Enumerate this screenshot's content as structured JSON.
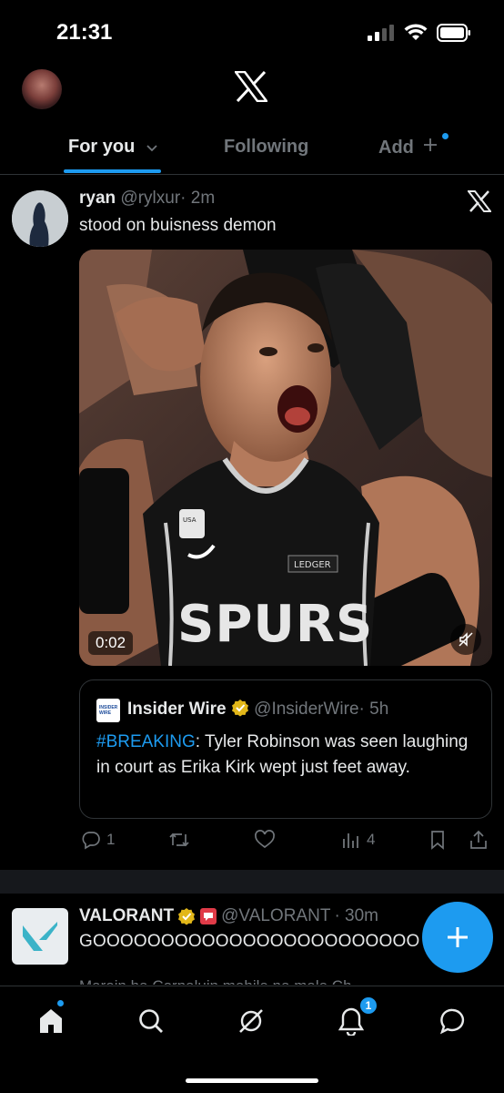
{
  "status_bar": {
    "time": "21:31"
  },
  "header": {
    "logo": "x-logo"
  },
  "tabs": [
    {
      "label": "For you",
      "active": true
    },
    {
      "label": "Following",
      "active": false
    },
    {
      "label": "Add",
      "active": false
    }
  ],
  "tweet1": {
    "name": "ryan",
    "handle": "@rylxur",
    "time": "· 2m",
    "text": "stood on buisness demon",
    "media": {
      "duration": "0:02",
      "muted": true,
      "jersey_text": "SPURS",
      "patch_text": "LEDGER"
    },
    "quote": {
      "avatar_text": "INSIDER WIRE",
      "name": "Insider Wire",
      "verified": true,
      "handle": "@InsiderWire",
      "time": "· 5h",
      "hashtag": "#BREAKING",
      "text": ": Tyler Robinson was seen laughing in court as Erika Kirk wept just feet away."
    },
    "actions": {
      "replies": "1",
      "reposts": "",
      "likes": "",
      "views": "4"
    }
  },
  "tweet2": {
    "name": "VALORANT",
    "verified": true,
    "handle": "@VALORANT",
    "time": "· 30m",
    "text": "GOOOOOOOOOOOOOOOOOOOOOOOO",
    "next_line": "Maroin ha Cornaluin mahile na male Ch"
  },
  "fab": {
    "label": "+"
  },
  "bottom_nav": {
    "items": [
      "home-icon",
      "search-icon",
      "grok-icon",
      "bell-icon",
      "messages-icon"
    ],
    "notification_count": "1"
  },
  "colors": {
    "accent": "#1d9bf0",
    "muted": "#71767b",
    "text": "#e7e9ea",
    "border": "#2f3336"
  }
}
